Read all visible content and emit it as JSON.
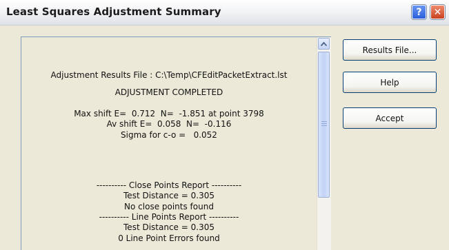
{
  "window": {
    "title": "Least Squares Adjustment Summary"
  },
  "titlebar": {
    "help_label": "?",
    "close_label": "✕"
  },
  "report": {
    "lines": [
      "Adjustment Results File : C:\\Temp\\CFEditPacketExtract.lst",
      "ADJUSTMENT COMPLETED",
      "Max shift E=  0.712  N=  -1.851 at point 3798",
      "Av shift E=  0.058  N=  -0.116",
      "Sigma for c-o =   0.052",
      "---------- Close Points Report ----------",
      "Test Distance = 0.305",
      "No close points found",
      "---------- Line Points Report ----------",
      "Test Distance = 0.305",
      "0 Line Point Errors found"
    ]
  },
  "buttons": {
    "results_file": "Results File...",
    "help": "Help",
    "accept": "Accept"
  },
  "icons": {
    "help": "question-mark-icon",
    "close": "close-x-icon",
    "scroll_up": "arrow-up-icon",
    "grip": "scroll-grip-icon"
  },
  "colors": {
    "dialog_background": "#ece9d8",
    "help_button": "#2a5fd9",
    "close_button": "#c8401f",
    "report_border": "#7f9db9"
  }
}
